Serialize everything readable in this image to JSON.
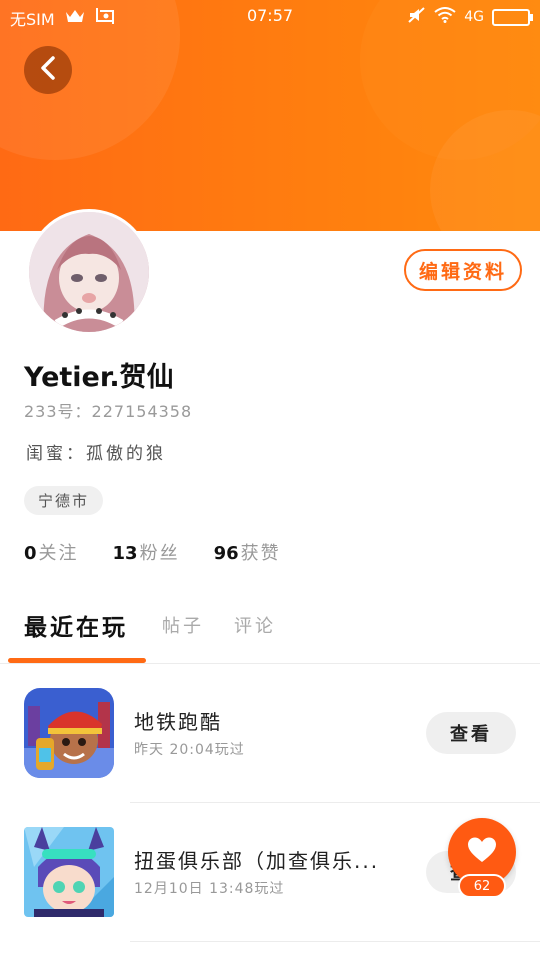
{
  "status_bar": {
    "sim": "无SIM",
    "time": "07:57",
    "network": "4G"
  },
  "profile": {
    "edit_label": "编辑资料",
    "username": "Yetier.贺仙",
    "id_line": "233号：227154358",
    "bestie_line": "闺蜜：孤傲的狼",
    "city_tag": "宁德市",
    "stats": [
      {
        "num": "0",
        "label": "关注"
      },
      {
        "num": "13",
        "label": "粉丝"
      },
      {
        "num": "96",
        "label": "获赞"
      }
    ]
  },
  "tabs": [
    {
      "label": "最近在玩",
      "active": true
    },
    {
      "label": "帖子",
      "active": false
    },
    {
      "label": "评论",
      "active": false
    }
  ],
  "games": [
    {
      "title": "地铁跑酷",
      "time": "昨天 20:04玩过",
      "button": "查看",
      "icon": "subway-surfers-icon"
    },
    {
      "title": "扭蛋俱乐部（加查俱乐...",
      "time": "12月10日 13:48玩过",
      "button": "查看",
      "icon": "gacha-club-icon"
    }
  ],
  "like": {
    "count": "62"
  },
  "colors": {
    "accent": "#ff6a14",
    "header_start": "#ff6a14",
    "header_end": "#ff8a0c"
  }
}
